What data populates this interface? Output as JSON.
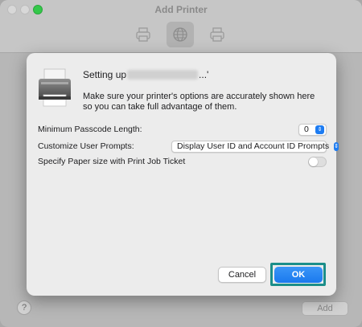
{
  "window": {
    "title": "Add Printer",
    "toolbar": [
      {
        "name": "default-printer-icon",
        "active": false
      },
      {
        "name": "ip-globe-icon",
        "active": true
      },
      {
        "name": "windows-printer-icon",
        "active": false
      }
    ],
    "help_label": "?",
    "add_label": "Add"
  },
  "sheet": {
    "title_prefix": "Setting up",
    "title_suffix": "...'",
    "description": "Make sure your printer's options are accurately shown here so you can take full advantage of them.",
    "options": [
      {
        "label": "Minimum Passcode Length:",
        "value": "0"
      },
      {
        "label": "Customize User Prompts:",
        "value": "Display User ID and Account ID Prompts"
      },
      {
        "label": "Specify Paper size with Print Job Ticket",
        "toggle": false
      }
    ],
    "cancel_label": "Cancel",
    "ok_label": "OK"
  },
  "colors": {
    "accent": "#1a79ee",
    "highlight": "#1b8e8a",
    "toggle_off": "#dedede"
  }
}
